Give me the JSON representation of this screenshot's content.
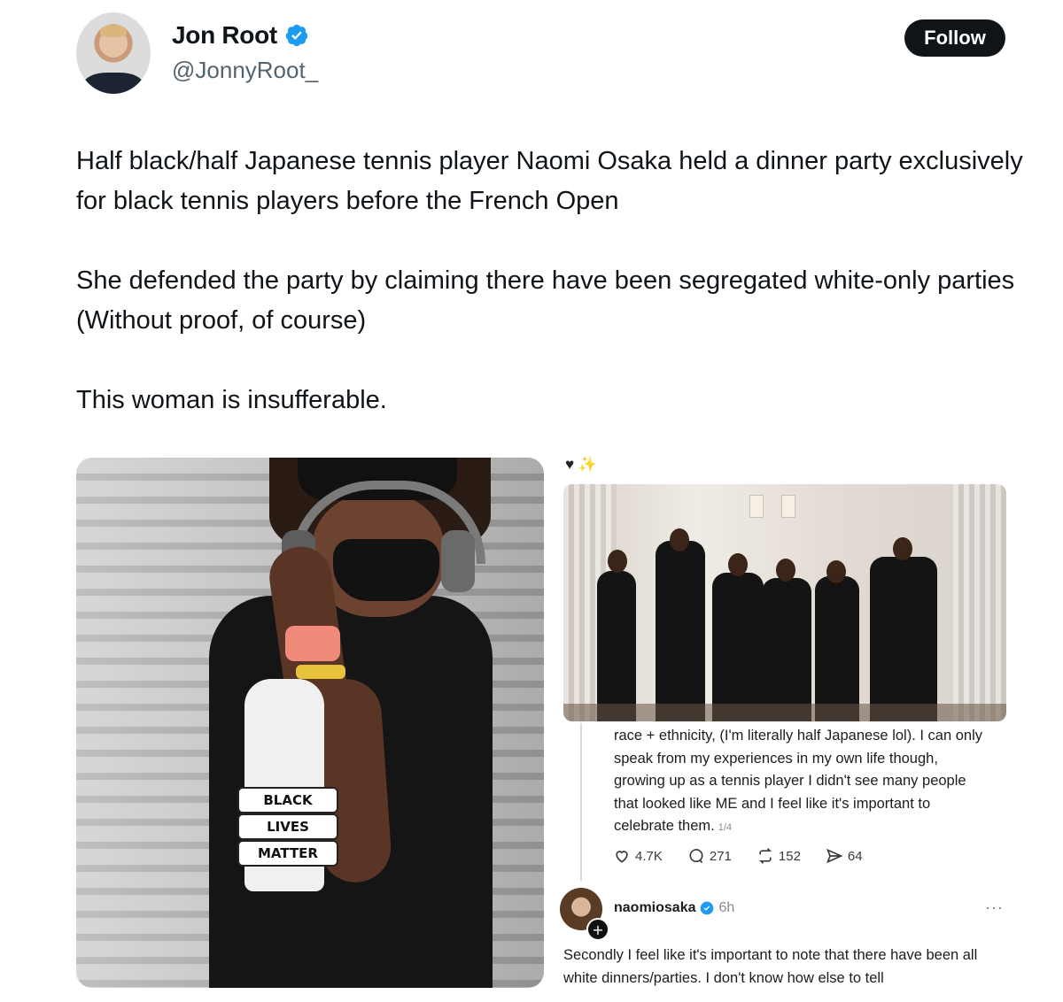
{
  "author": {
    "name": "Jon Root",
    "handle": "@JonnyRoot_",
    "verified": true
  },
  "follow_label": "Follow",
  "tweet": {
    "paragraphs": [
      "Half black/half Japanese tennis player Naomi Osaka held a dinner party exclusively for black tennis players before the French Open",
      "She defended the party by claiming there have been segregated white-only parties (Without proof, of course)",
      "This woman is insufferable."
    ]
  },
  "left_photo": {
    "band_lines": [
      "BLACK",
      "LIVES",
      "MATTER"
    ]
  },
  "embedded_post": {
    "top_icons": "♥ ✨",
    "caption": "race + ethnicity, (I'm literally half Japanese lol). I can only speak from my experiences in my own life though, growing up as a tennis player I didn't see many people that looked like ME and I feel like it's important to celebrate them.",
    "pager": "1/4",
    "stats": {
      "likes": "4.7K",
      "replies": "271",
      "reposts": "152",
      "shares": "64"
    },
    "reply": {
      "username": "naomiosaka",
      "time": "6h",
      "more": "···",
      "plus": "+",
      "text": "Secondly I feel like it's important to note that there have been all white dinners/parties. I don't know how else to tell"
    }
  },
  "colors": {
    "verified_badge": "#1d9bf0",
    "follow_bg": "#0f1419",
    "text_secondary": "#536471"
  }
}
